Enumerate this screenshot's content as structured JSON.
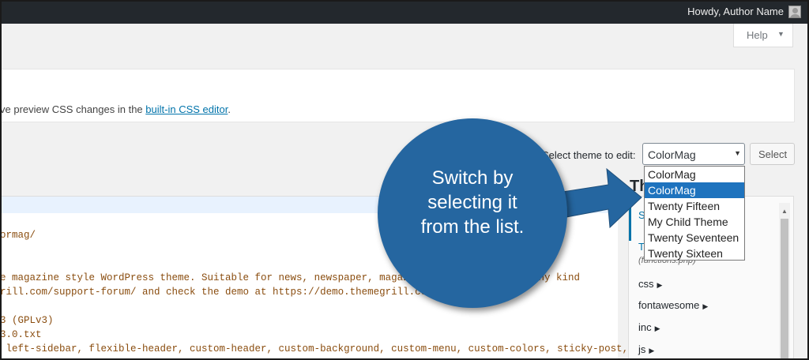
{
  "admin_bar": {
    "greeting": "Howdy, Author Name"
  },
  "help_button": {
    "label": "Help",
    "caret": "▼"
  },
  "notice": {
    "text_prefix": "ve preview CSS changes in the ",
    "link": "built-in CSS editor",
    "text_suffix": "."
  },
  "theme_select": {
    "label": "Select theme to edit:",
    "selected": "ColorMag",
    "options": [
      "ColorMag",
      "ColorMag",
      "Twenty Fifteen",
      "My Child Theme",
      "Twenty Seventeen",
      "Twenty Sixteen"
    ],
    "highlighted_index": 1,
    "button": "Select"
  },
  "code_lines": [
    "ormag/",
    "",
    "e magazine style WordPress theme. Suitable for news, newspaper, magazine, p",
    "rill.com/support-forum/ and check the demo at https://demo.themegrill.com/colormag/",
    "",
    "3 (GPLv3)",
    "3.0.txt",
    " left-sidebar, flexible-header, custom-header, custom-background, custom-menu, custom-colors, sticky-post,"
  ],
  "code_fragment_right": "ess and any kind",
  "files_panel": {
    "title": "Th",
    "top_item": "S",
    "top_item2": "T",
    "top_item2_sub": "(functions.php)",
    "dirs": [
      "css",
      "fontawesome",
      "inc",
      "js"
    ]
  },
  "callout": {
    "line1": "Switch by",
    "line2": "selecting it",
    "line3": "from the list."
  },
  "colors": {
    "admin_bar": "#23282d",
    "callout": "#2566a0",
    "highlight": "#1e73be",
    "link": "#0073aa",
    "code": "#8a4d0f"
  }
}
